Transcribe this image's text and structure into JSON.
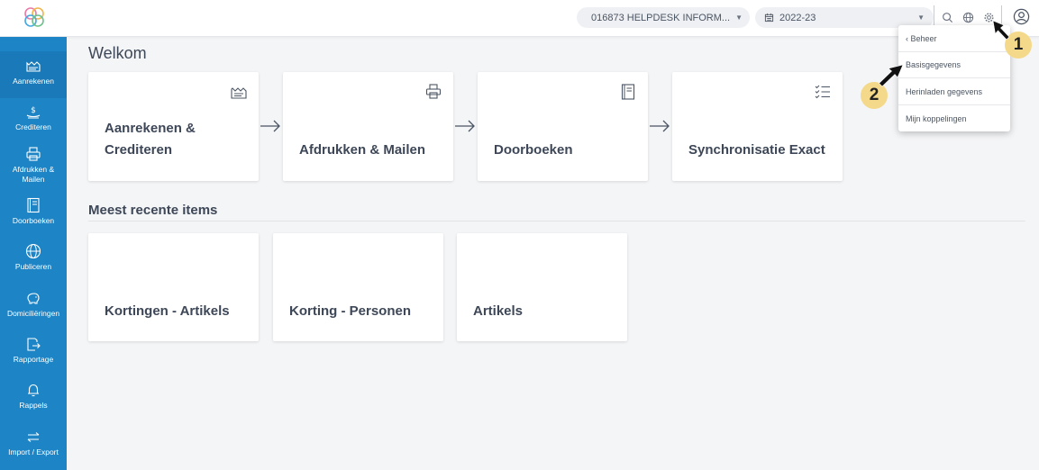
{
  "topbar": {
    "company_label": "016873 HELPDESK INFORM...",
    "year_label": "2022-23",
    "icons": [
      "logo-icon",
      "company-icon",
      "calendar-icon",
      "search-icon",
      "globe-icon",
      "gear-icon",
      "user-icon"
    ]
  },
  "sidebar": {
    "items": [
      {
        "label": "Aanrekenen",
        "icon": "invoice-icon"
      },
      {
        "label": "Crediteren",
        "icon": "credit-icon"
      },
      {
        "label": "Afdrukken &\nMailen",
        "label_line1": "Afdrukken &",
        "label_line2": "Mailen",
        "icon": "printer-icon"
      },
      {
        "label": "Doorboeken",
        "icon": "book-icon"
      },
      {
        "label": "Publiceren",
        "icon": "globe-icon"
      },
      {
        "label": "Domiciliëringen",
        "icon": "piggybank-icon"
      },
      {
        "label": "Rapportage",
        "icon": "report-icon"
      },
      {
        "label": "Rappels",
        "icon": "bell-icon"
      },
      {
        "label": "Import / Export",
        "icon": "transfer-icon"
      }
    ]
  },
  "main": {
    "title": "Welkom",
    "workflow": [
      {
        "line1": "Aanrekenen &",
        "line2": "Crediteren",
        "icon": "invoice-icon"
      },
      {
        "line1": "Afdrukken & Mailen",
        "line2": "",
        "icon": "printer-icon"
      },
      {
        "line1": "Doorboeken",
        "line2": "",
        "icon": "book-icon"
      },
      {
        "line1": "Synchronisatie Exact",
        "line2": "",
        "icon": "checklist-icon"
      }
    ],
    "recent_title": "Meest recente items",
    "recent": [
      {
        "label": "Kortingen - Artikels"
      },
      {
        "label": "Korting - Personen"
      },
      {
        "label": "Artikels"
      }
    ]
  },
  "dropdown": {
    "items": [
      "‹ Beheer",
      "Basisgegevens",
      "Herinladen gegevens",
      "Mijn koppelingen"
    ]
  },
  "annotations": {
    "badge1": "1",
    "badge2": "2"
  },
  "colors": {
    "sidebar": "#1d84c6",
    "badge": "#f4d98a",
    "text": "#3d4757"
  }
}
